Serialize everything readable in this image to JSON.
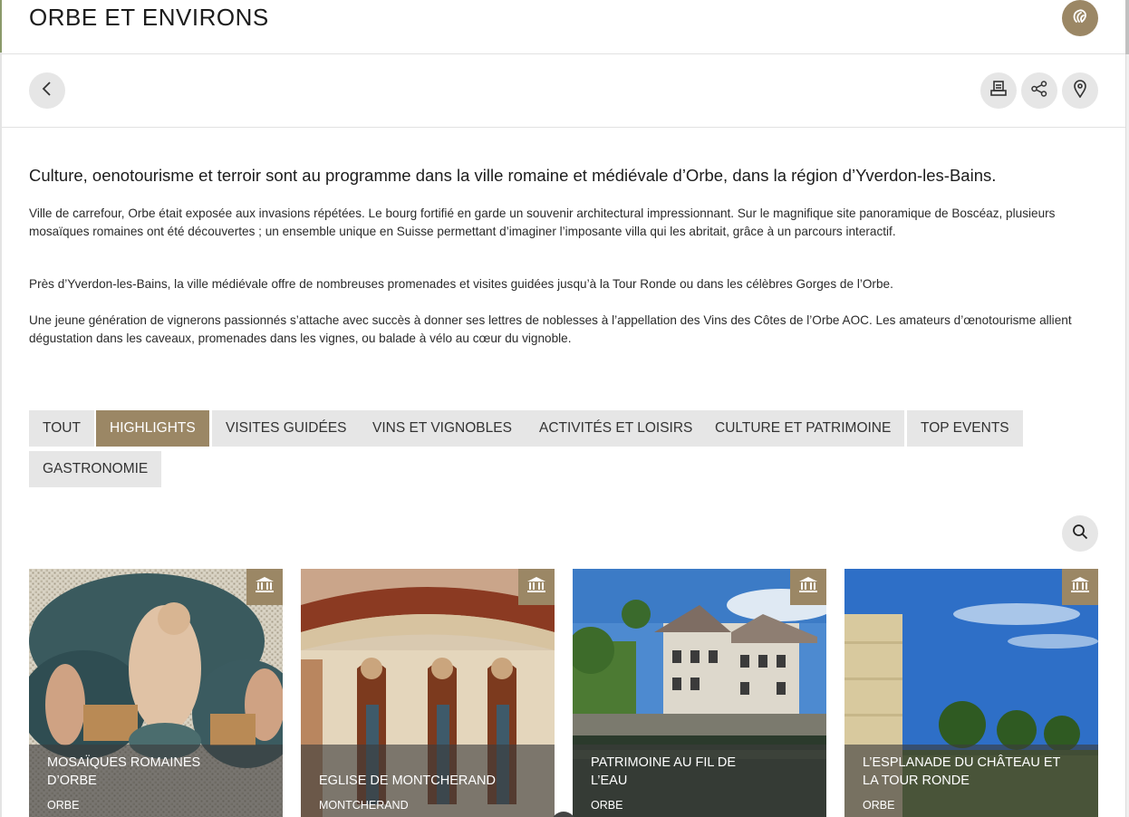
{
  "header": {
    "title": "ORBE ET ENVIRONS",
    "brand_icon": "region-logo-icon"
  },
  "toolbar": {
    "back_icon": "chevron-left-icon",
    "print_icon": "print-icon",
    "share_icon": "share-icon",
    "map_icon": "map-pin-icon"
  },
  "intro": {
    "lead": "Culture, oenotourisme et terroir sont au programme dans la ville romaine et médiévale d’Orbe, dans la région d’Yverdon-les-Bains.",
    "paragraphs": [
      "Ville de carrefour, Orbe était exposée aux invasions répétées. Le bourg fortifié en garde un souvenir architectural impressionnant. Sur le magnifique site panoramique de Boscéaz, plusieurs mosaïques romaines ont été découvertes ; un ensemble unique en Suisse permettant d’imaginer l’imposante villa qui les abritait, grâce à un parcours interactif.",
      "Près d’Yverdon-les-Bains, la ville médiévale offre de nombreuses promenades et visites guidées jusqu’à la Tour Ronde ou dans les célèbres Gorges de l’Orbe.",
      "Une jeune génération de vignerons passionnés s’attache avec succès à donner ses lettres de noblesses à l’appellation des Vins des Côtes de l’Orbe AOC. Les amateurs d’œnotourisme allient dégustation dans les caveaux, promenades dans les vignes, ou balade à vélo au cœur du vignoble."
    ]
  },
  "filters": {
    "active": "HIGHLIGHTS",
    "items": [
      "TOUT",
      "HIGHLIGHTS",
      "VISITES GUIDÉES",
      "VINS ET VIGNOBLES",
      "ACTIVITÉS ET LOISIRS",
      "CULTURE ET PATRIMOINE",
      "TOP EVENTS",
      "GASTRONOMIE"
    ]
  },
  "search": {
    "icon": "search-icon"
  },
  "cards": [
    {
      "title": "MOSAÏQUES ROMAINES D’ORBE",
      "location": "ORBE",
      "category_icon": "museum-icon"
    },
    {
      "title": "EGLISE DE MONTCHERAND",
      "location": "MONTCHERAND",
      "category_icon": "museum-icon"
    },
    {
      "title": "PATRIMOINE AU FIL DE L’EAU",
      "location": "ORBE",
      "category_icon": "museum-icon"
    },
    {
      "title": "L’ESPLANADE DU CHÂTEAU ET LA TOUR RONDE",
      "location": "ORBE",
      "category_icon": "museum-icon"
    }
  ],
  "colors": {
    "accent": "#9b8765",
    "chip_bg": "#e6e6e6",
    "text": "#1c1c1c"
  }
}
